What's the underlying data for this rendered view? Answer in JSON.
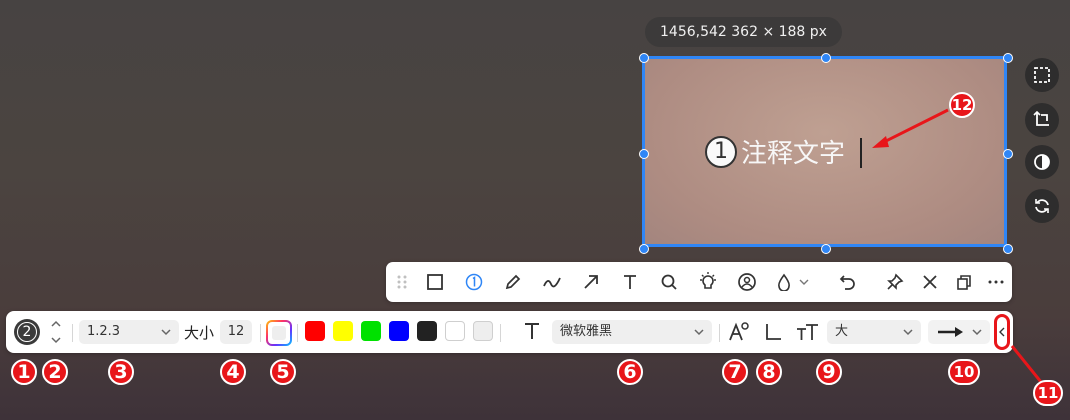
{
  "selection": {
    "dimensions_label": "1456,542  362 × 188  px"
  },
  "annotation": {
    "number": "1",
    "text": "注释文字"
  },
  "callouts": [
    "1",
    "2",
    "3",
    "4",
    "5",
    "6",
    "7",
    "8",
    "9",
    "10",
    "11",
    "12"
  ],
  "toolbar2": {
    "step_number": "2",
    "number_format": "1.2.3",
    "size_label": "大小",
    "size_value": "12",
    "font_name": "微软雅黑",
    "text_size": "大",
    "colors": [
      "#ff0000",
      "#ffff00",
      "#00e100",
      "#0000ff",
      "#222222",
      "#ffffff",
      "#eeeeee"
    ]
  },
  "colors": {
    "accent": "#2f86f6",
    "callout_red": "#e8161a"
  }
}
